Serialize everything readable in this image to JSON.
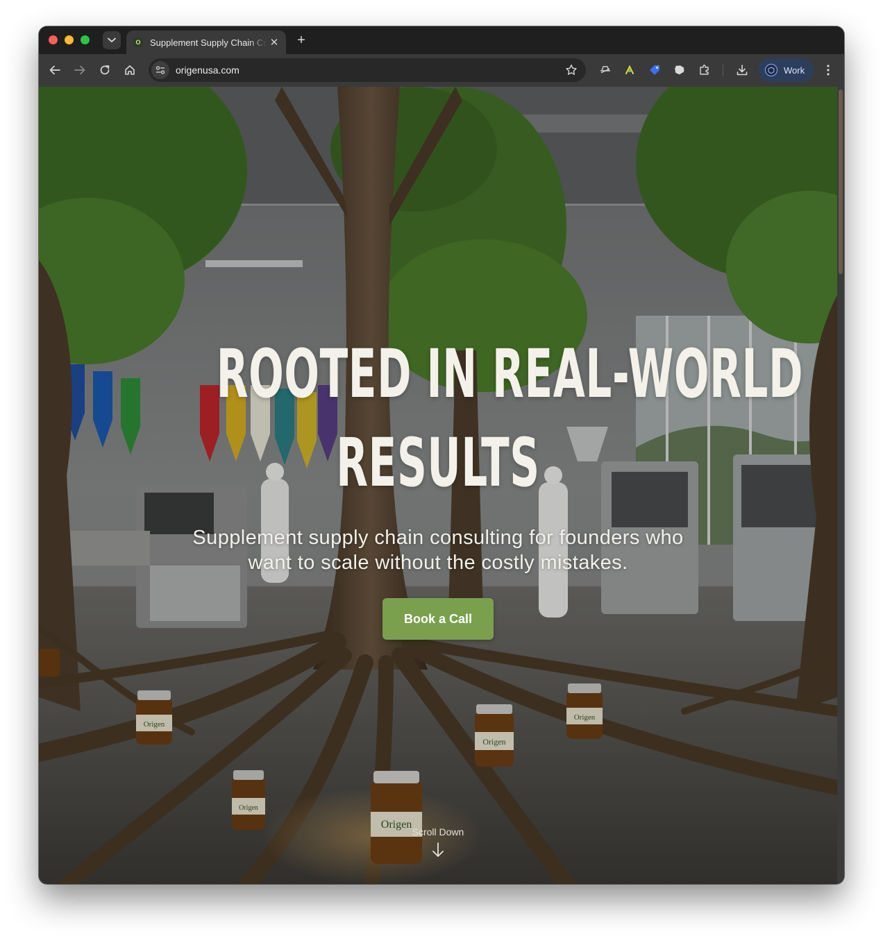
{
  "browser": {
    "tab": {
      "title": "Supplement Supply Chain Consulting",
      "favicon_letter": "O"
    },
    "address_bar": {
      "url": "origenusa.com"
    },
    "profile": {
      "label": "Work"
    },
    "extensions": [
      "incognito-hat-icon",
      "mentor-extension-icon",
      "tag-extension-icon",
      "puzzle-shape-icon",
      "extensions-icon"
    ]
  },
  "hero": {
    "headline_line1": "ROOTED IN REAL-WORLD",
    "headline_line2": "RESULTS",
    "subheadline_line1": "Supplement supply chain consulting for founders who",
    "subheadline_line2": "want to scale without the costly mistakes.",
    "cta_label": "Book a Call",
    "scroll_label": "Scroll Down",
    "bottle_brand": "Origen",
    "colors": {
      "cta": "#7aa04e",
      "headline": "#f4f1ea",
      "foliage": "#4d7d2a",
      "bark": "#5a4630"
    }
  }
}
